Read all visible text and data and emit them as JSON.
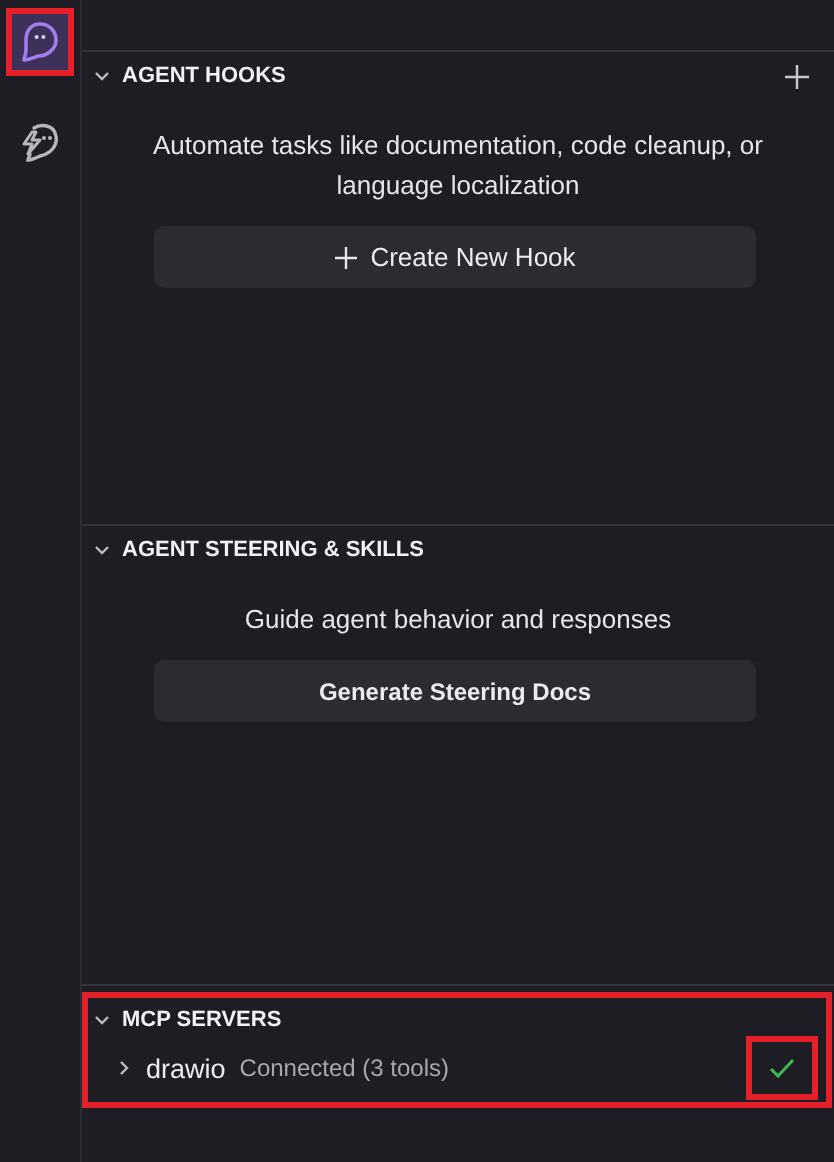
{
  "activity_bar": [
    {
      "kind": "ghost",
      "selected": true,
      "highlighted": true
    },
    {
      "kind": "ghost-bolt",
      "selected": false,
      "highlighted": false
    }
  ],
  "sections": [
    {
      "kind": "hooks",
      "title": "AGENT HOOKS",
      "expanded": true,
      "add_button": true,
      "description": "Automate tasks like documentation, code cleanup, or language localization",
      "button": {
        "label": "Create New Hook",
        "plus": true
      }
    },
    {
      "kind": "steering",
      "title": "AGENT STEERING & SKILLS",
      "expanded": true,
      "description": "Guide agent behavior and responses",
      "button": {
        "label": "Generate Steering Docs"
      }
    },
    {
      "kind": "mcp",
      "title": "MCP SERVERS",
      "expanded": true,
      "highlighted": true,
      "servers": [
        {
          "name": "drawio",
          "status": "Connected (3 tools)",
          "expanded": false,
          "connected": true,
          "check_highlighted": true
        }
      ]
    }
  ]
}
